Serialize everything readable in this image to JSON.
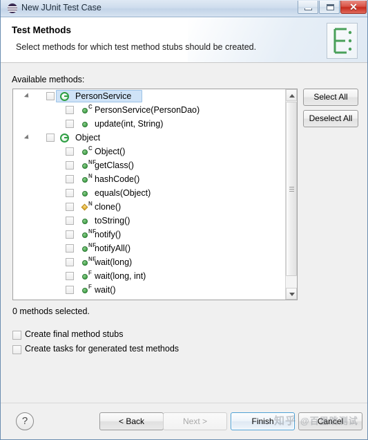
{
  "window": {
    "title": "New JUnit Test Case",
    "icon": "junit-icon",
    "controls": {
      "minimize": "minimize-icon",
      "maximize": "maximize-icon",
      "close": "✕"
    }
  },
  "header": {
    "title": "Test Methods",
    "description": "Select methods for which test method stubs should be created.",
    "banner_icon": "junit-wizard-banner-icon"
  },
  "main": {
    "available_label": "Available methods:",
    "status": "0 methods selected.",
    "side_buttons": {
      "select_all": "Select All",
      "deselect_all": "Deselect All"
    },
    "tree": [
      {
        "label": "PersonService",
        "kind": "class",
        "depth": 0,
        "expanded": true,
        "checked": false,
        "selected": true,
        "badge": ""
      },
      {
        "label": "PersonService(PersonDao)",
        "kind": "method",
        "depth": 1,
        "expanded": false,
        "checked": false,
        "selected": false,
        "badge": "C"
      },
      {
        "label": "update(int, String)",
        "kind": "method",
        "depth": 1,
        "expanded": false,
        "checked": false,
        "selected": false,
        "badge": ""
      },
      {
        "label": "Object",
        "kind": "class",
        "depth": 0,
        "expanded": true,
        "checked": false,
        "selected": false,
        "badge": ""
      },
      {
        "label": "Object()",
        "kind": "method",
        "depth": 1,
        "expanded": false,
        "checked": false,
        "selected": false,
        "badge": "C"
      },
      {
        "label": "getClass()",
        "kind": "method",
        "depth": 1,
        "expanded": false,
        "checked": false,
        "selected": false,
        "badge": "NF"
      },
      {
        "label": "hashCode()",
        "kind": "method",
        "depth": 1,
        "expanded": false,
        "checked": false,
        "selected": false,
        "badge": "N"
      },
      {
        "label": "equals(Object)",
        "kind": "method",
        "depth": 1,
        "expanded": false,
        "checked": false,
        "selected": false,
        "badge": ""
      },
      {
        "label": "clone()",
        "kind": "protected-method",
        "depth": 1,
        "expanded": false,
        "checked": false,
        "selected": false,
        "badge": "N"
      },
      {
        "label": "toString()",
        "kind": "method",
        "depth": 1,
        "expanded": false,
        "checked": false,
        "selected": false,
        "badge": ""
      },
      {
        "label": "notify()",
        "kind": "method",
        "depth": 1,
        "expanded": false,
        "checked": false,
        "selected": false,
        "badge": "NF"
      },
      {
        "label": "notifyAll()",
        "kind": "method",
        "depth": 1,
        "expanded": false,
        "checked": false,
        "selected": false,
        "badge": "NF"
      },
      {
        "label": "wait(long)",
        "kind": "method",
        "depth": 1,
        "expanded": false,
        "checked": false,
        "selected": false,
        "badge": "NF"
      },
      {
        "label": "wait(long, int)",
        "kind": "method",
        "depth": 1,
        "expanded": false,
        "checked": false,
        "selected": false,
        "badge": "F"
      },
      {
        "label": "wait()",
        "kind": "method",
        "depth": 1,
        "expanded": false,
        "checked": false,
        "selected": false,
        "badge": "F"
      }
    ],
    "options": [
      {
        "label": "Create final method stubs",
        "checked": false
      },
      {
        "label": "Create tasks for generated test methods",
        "checked": false
      }
    ]
  },
  "footer": {
    "help": "?",
    "back": "< Back",
    "next": "Next >",
    "finish": "Finish",
    "cancel": "Cancel"
  },
  "watermark": {
    "primary": "知乎",
    "secondary": "@百里跳测试"
  }
}
